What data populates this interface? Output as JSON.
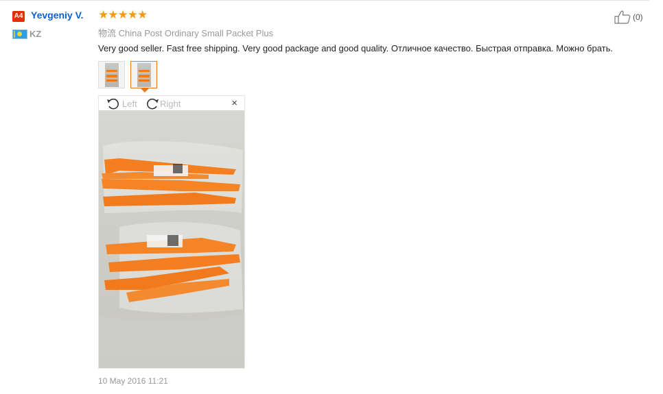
{
  "reviewer": {
    "badge": "A4",
    "name": "Yevgeniy V.",
    "country": "KZ",
    "flag_icon": "kazakhstan-flag-icon"
  },
  "rating": {
    "stars": 5,
    "max": 5,
    "star_glyphs": "★★★★★",
    "color": "#f39c12"
  },
  "shipping": {
    "cn_label": "物流",
    "method": "China Post Ordinary Small Packet Plus"
  },
  "review_text": "Very good seller. Fast free shipping. Very good package and good quality. Отличное качество. Быстрая отправка. Можно брать.",
  "helpful": {
    "count_label": "(0)",
    "icon": "thumbs-up-icon"
  },
  "thumbnails": [
    {
      "icon": "photo-thumbnail",
      "selected": false
    },
    {
      "icon": "photo-thumbnail",
      "selected": true
    }
  ],
  "viewer": {
    "rotate_left_label": "Left",
    "rotate_right_label": "Right",
    "close_glyph": "×"
  },
  "timestamp": "10 May 2016 11:21",
  "colors": {
    "accent": "#e8781c",
    "link": "#0b5ed7",
    "badge": "#e62e04"
  }
}
